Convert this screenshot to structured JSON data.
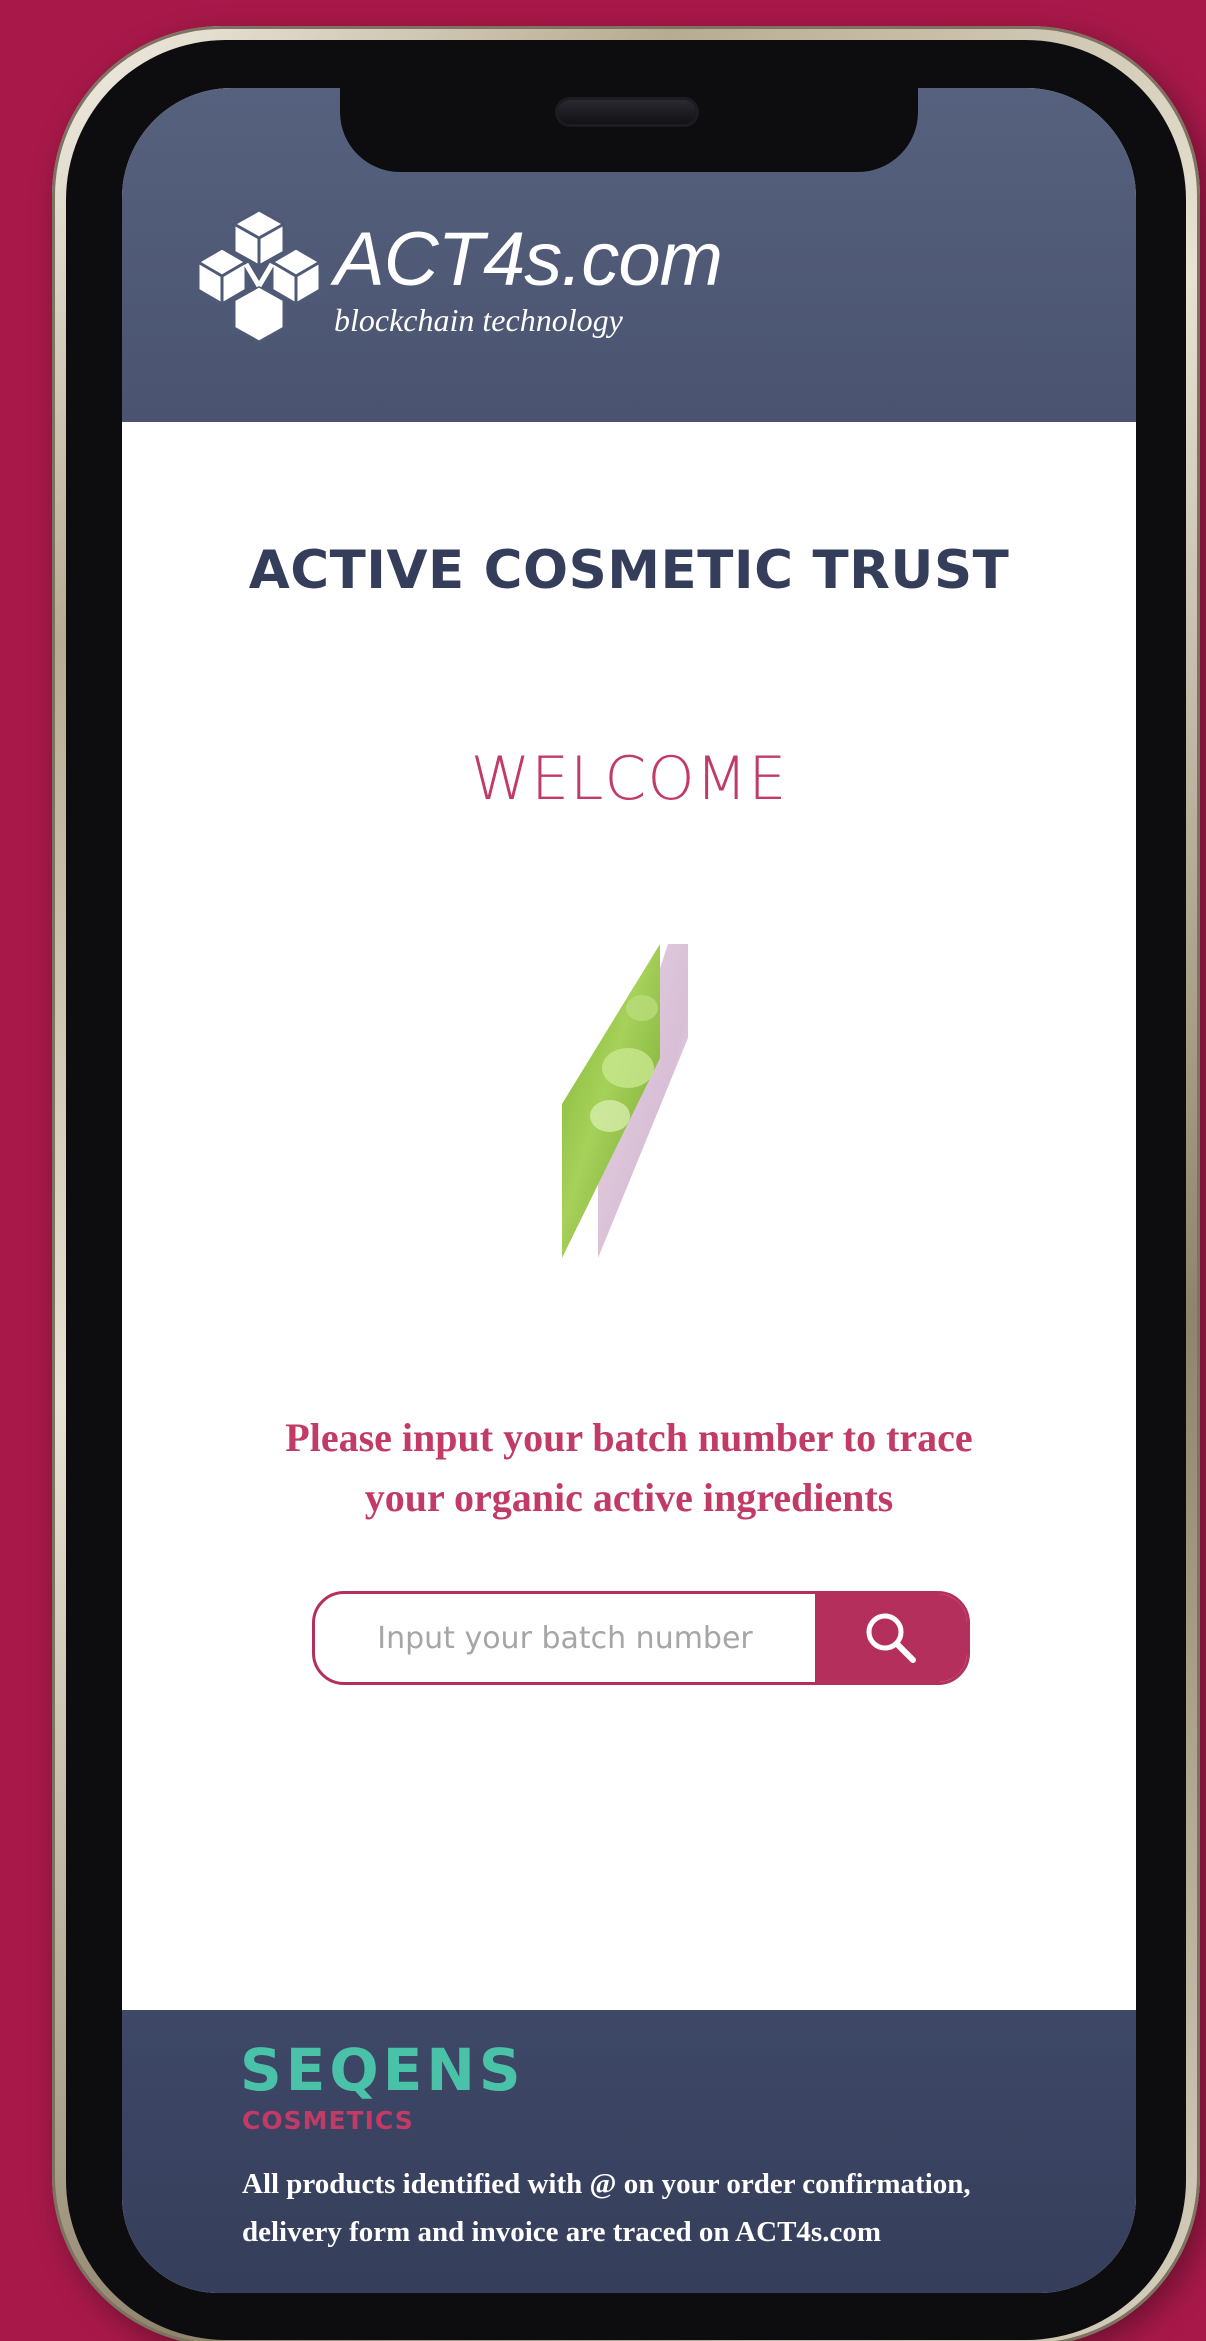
{
  "header": {
    "logo_name": "ACT4s.com",
    "logo_tagline": "blockchain technology"
  },
  "main": {
    "title": "ACTIVE COSMETIC TRUST",
    "welcome": "WELCOME",
    "prompt_line1": "Please input your batch number to trace",
    "prompt_line2": "your organic active ingredients",
    "search": {
      "placeholder": "Input your batch number",
      "value": ""
    }
  },
  "footer": {
    "brand_name": "SEQENS",
    "brand_sub": "COSMETICS",
    "note_line1": "All products identified with @ on your order confirmation,",
    "note_line2": "delivery form and invoice are traced on ACT4s.com"
  },
  "colors": {
    "background": "#a8194a",
    "header": "#4f5a76",
    "accent": "#c23a66",
    "title": "#343e5a",
    "brand_teal": "#49c2a8"
  },
  "icons": {
    "logo": "cube-cluster-icon",
    "search": "search-icon"
  }
}
